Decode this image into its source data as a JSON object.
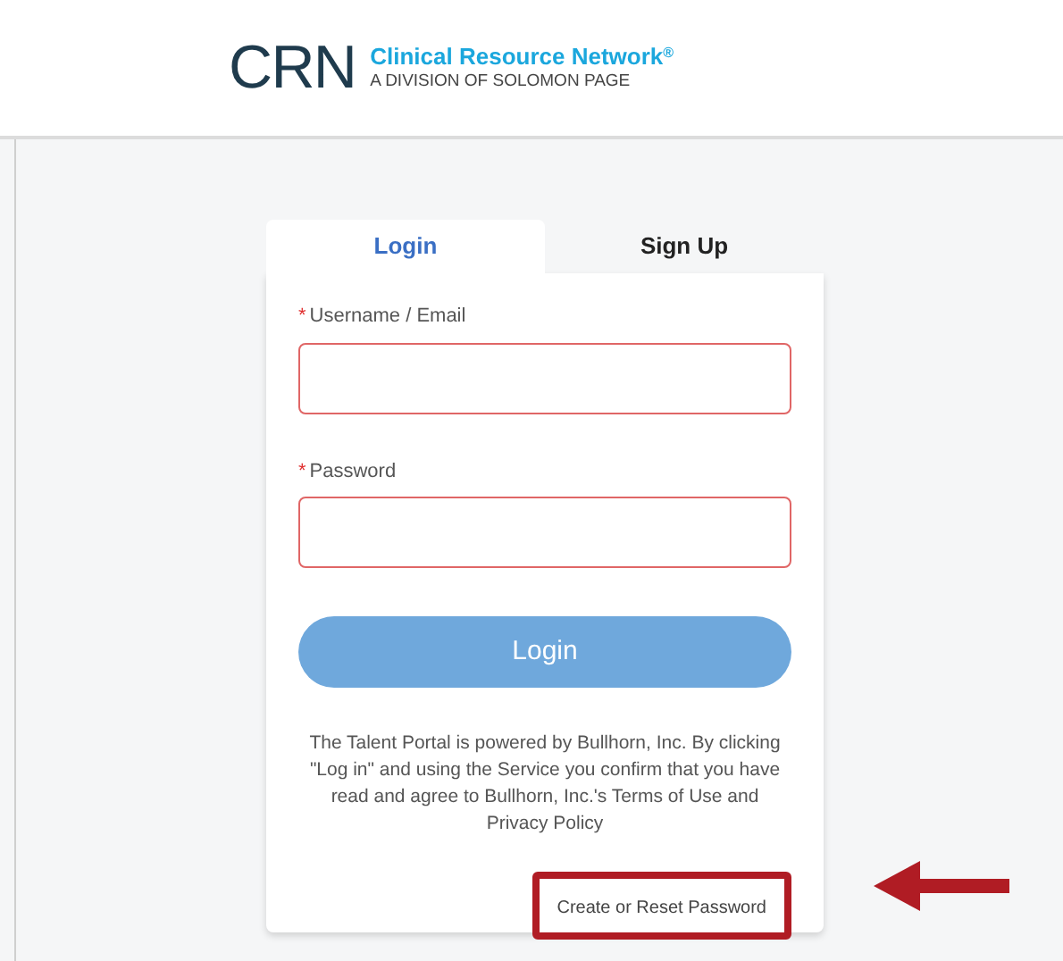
{
  "header": {
    "logo_mark": "CRN",
    "brand_name": "Clinical Resource Network",
    "brand_mark": "®",
    "tagline": "A DIVISION OF SOLOMON PAGE"
  },
  "tabs": [
    {
      "label": "Login",
      "selected": true
    },
    {
      "label": "Sign Up",
      "selected": false
    }
  ],
  "fields": [
    {
      "required_mark": "*",
      "label": "Username / Email",
      "invalid": true
    },
    {
      "required_mark": "*",
      "label": "Password",
      "invalid": true
    }
  ],
  "login_button": "Login",
  "disclaimer": "The Talent Portal is powered by Bullhorn, Inc. By clicking \"Log in\" and using the Service you confirm that you have read and agree to Bullhorn, Inc.'s Terms of Use and Privacy Policy",
  "reset_link": "Create or Reset Password"
}
